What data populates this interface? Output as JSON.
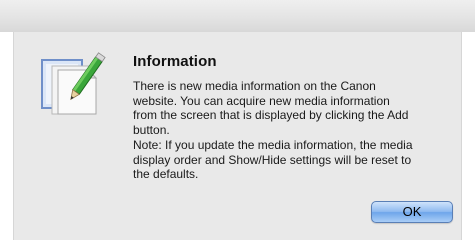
{
  "dialog": {
    "title": "Information",
    "message_lines": [
      "There is new media information on the Canon",
      "website. You can acquire new media information",
      "from the screen that is displayed by clicking the Add",
      "button.",
      "Note: If you update the media information, the media",
      "display order and Show/Hide settings will be reset to",
      "the defaults."
    ],
    "ok_label": "OK",
    "icon": "document-edit-icon"
  },
  "colors": {
    "panel_background": "#e9e9e9",
    "button_accent": "#6ea6ea"
  }
}
